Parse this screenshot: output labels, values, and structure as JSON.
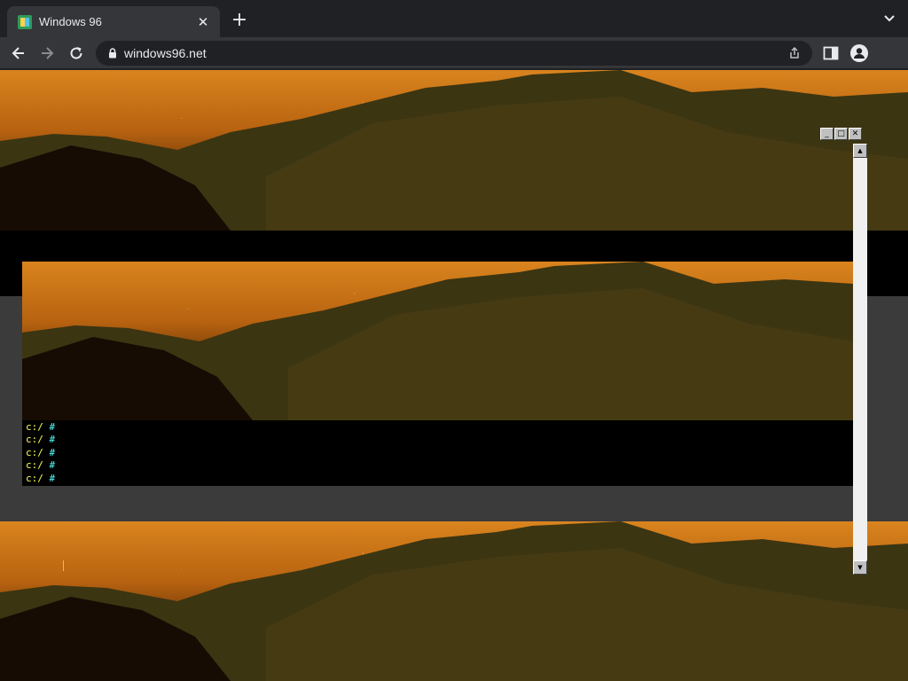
{
  "browser": {
    "tab": {
      "title": "Windows 96",
      "close_icon": "close-icon",
      "favicon": "windows96-favicon"
    },
    "new_tab_label": "+",
    "tab_search_icon": "chevron-down-icon",
    "nav": {
      "back_icon": "back-arrow-icon",
      "forward_icon": "forward-arrow-icon",
      "reload_icon": "reload-icon"
    },
    "address_bar": {
      "url": "windows96.net",
      "lock_icon": "lock-icon"
    },
    "share_icon": "share-icon",
    "side_panel_icon": "side-panel-icon",
    "profile_icon": "profile-icon"
  },
  "window": {
    "controls": {
      "minimize": "_",
      "maximize": "□",
      "close": "✕"
    },
    "scrollbar": {
      "up": "▲",
      "down": "▼"
    }
  },
  "terminal": {
    "lines": [
      {
        "path": "c:/",
        "symbol": "#"
      },
      {
        "path": "c:/",
        "symbol": "#"
      },
      {
        "path": "c:/",
        "symbol": "#"
      },
      {
        "path": "c:/",
        "symbol": "#"
      },
      {
        "path": "c:/",
        "symbol": "#"
      }
    ]
  },
  "colors": {
    "prompt_path": "#ffff55",
    "prompt_symbol": "#55ffff",
    "chrome_dark": "#202124",
    "chrome_toolbar": "#35363a"
  }
}
